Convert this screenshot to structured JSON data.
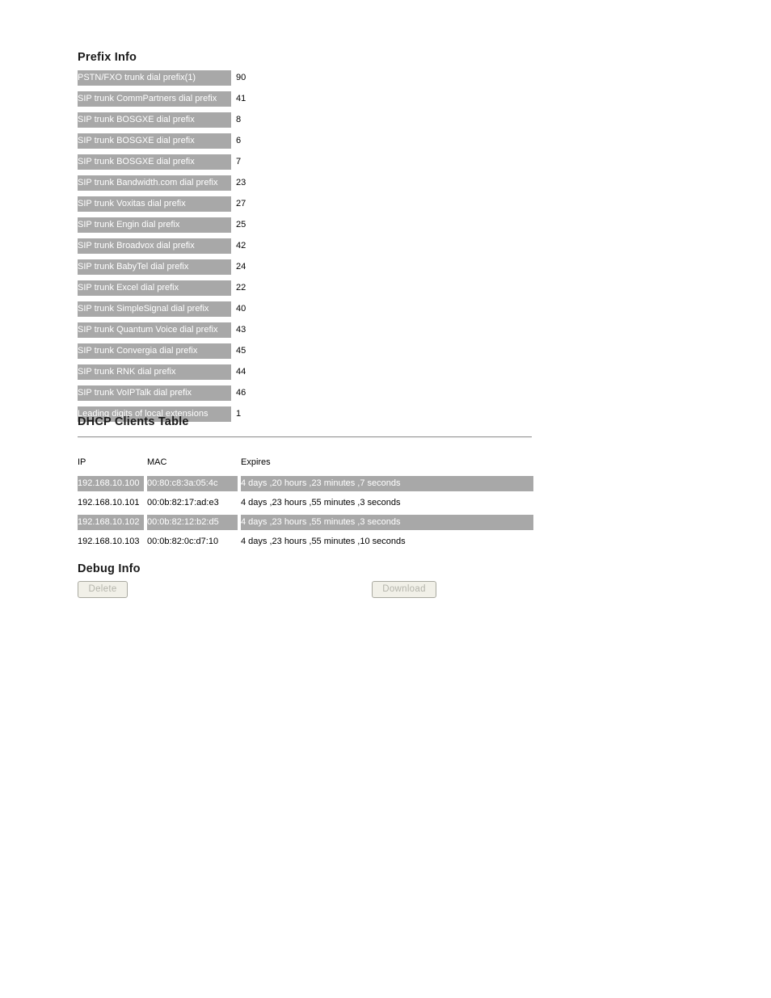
{
  "prefix_info": {
    "title": "Prefix Info",
    "rows": [
      {
        "label": "PSTN/FXO trunk dial prefix(1)",
        "value": "90"
      },
      {
        "label": "SIP trunk CommPartners dial prefix",
        "value": "41"
      },
      {
        "label": "SIP trunk BOSGXE dial prefix",
        "value": "8"
      },
      {
        "label": "SIP trunk BOSGXE dial prefix",
        "value": "6"
      },
      {
        "label": "SIP trunk BOSGXE dial prefix",
        "value": "7"
      },
      {
        "label": "SIP trunk Bandwidth.com dial prefix",
        "value": "23"
      },
      {
        "label": "SIP trunk Voxitas dial prefix",
        "value": "27"
      },
      {
        "label": "SIP trunk Engin dial prefix",
        "value": "25"
      },
      {
        "label": "SIP trunk Broadvox dial prefix",
        "value": "42"
      },
      {
        "label": "SIP trunk BabyTel dial prefix",
        "value": "24"
      },
      {
        "label": "SIP trunk Excel dial prefix",
        "value": "22"
      },
      {
        "label": "SIP trunk SimpleSignal dial prefix",
        "value": "40"
      },
      {
        "label": "SIP trunk Quantum Voice dial prefix",
        "value": "43"
      },
      {
        "label": "SIP trunk Convergia dial prefix",
        "value": "45"
      },
      {
        "label": "SIP trunk RNK dial prefix",
        "value": "44"
      },
      {
        "label": "SIP trunk VoIPTalk dial prefix",
        "value": "46"
      },
      {
        "label": "Leading digits of local extensions",
        "value": "1"
      }
    ]
  },
  "dhcp": {
    "title": "DHCP Clients Table",
    "headers": {
      "ip": "IP",
      "mac": "MAC",
      "expires": "Expires"
    },
    "rows": [
      {
        "ip": "192.168.10.100",
        "mac": "00:80:c8:3a:05:4c",
        "expires": "4 days ,20 hours ,23 minutes ,7 seconds",
        "shaded": true
      },
      {
        "ip": "192.168.10.101",
        "mac": "00:0b:82:17:ad:e3",
        "expires": "4 days ,23 hours ,55 minutes ,3 seconds",
        "shaded": false
      },
      {
        "ip": "192.168.10.102",
        "mac": "00:0b:82:12:b2:d5",
        "expires": "4 days ,23 hours ,55 minutes ,3 seconds",
        "shaded": true
      },
      {
        "ip": "192.168.10.103",
        "mac": "00:0b:82:0c:d7:10",
        "expires": "4 days ,23 hours ,55 minutes ,10 seconds",
        "shaded": false
      }
    ]
  },
  "debug": {
    "title": "Debug Info",
    "delete_label": "Delete",
    "download_label": "Download"
  },
  "colors": {
    "row_shade": "#a8a8a8",
    "row_shade_text": "#ffffff",
    "button_face": "#f1f0e8",
    "button_border": "#a9a9a0",
    "button_text_disabled": "#b4b4ab",
    "rule": "#9a9a9a"
  }
}
